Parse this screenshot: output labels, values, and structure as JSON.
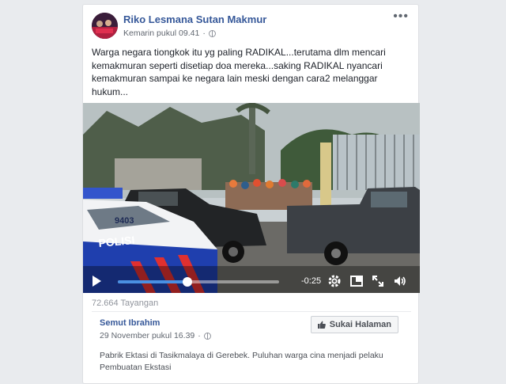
{
  "post": {
    "author": "Riko Lesmana Sutan Makmur",
    "timestamp": "Kemarin pukul 09.41",
    "privacy_icon": "globe-icon",
    "text": "Warga negara tiongkok itu yg paling RADIKAL...terutama dlm mencari kemakmuran seperti disetiap doa mereka...saking RADIKAL nyancari kemakmuran sampai ke negara lain meski dengan cara2 melanggar hukum..."
  },
  "video": {
    "time_remaining": "-0:25",
    "progress": 0.43,
    "car_plate": "9403",
    "car_text": "POLISI"
  },
  "views": "72.664 Tayangan",
  "shared": {
    "author": "Semut Ibrahim",
    "timestamp": "29 November pukul 16.39",
    "like_label": "Sukai Halaman",
    "text": "Pabrik Ektasi di Tasikmalaya di Gerebek. Puluhan warga cina menjadi pelaku Pembuatan Ekstasi"
  },
  "colors": {
    "link": "#365899",
    "progress": "#4a90e2"
  }
}
